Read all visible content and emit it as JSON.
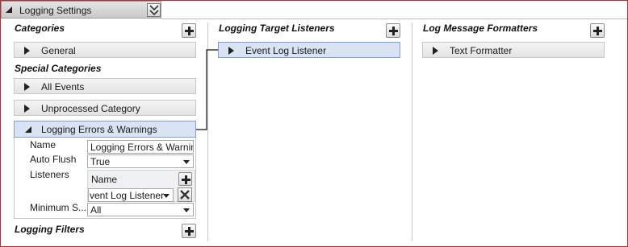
{
  "header": {
    "title": "Logging Settings"
  },
  "categories": {
    "label": "Categories",
    "items": [
      {
        "label": "General"
      }
    ]
  },
  "special_categories": {
    "label": "Special Categories",
    "items": [
      {
        "label": "All Events"
      },
      {
        "label": "Unprocessed Category"
      },
      {
        "label": "Logging Errors & Warnings"
      }
    ]
  },
  "properties": {
    "name_label": "Name",
    "name_value": "Logging Errors & Warning",
    "auto_flush_label": "Auto Flush",
    "auto_flush_value": "True",
    "listeners_label": "Listeners",
    "listeners_name_header": "Name",
    "listener_value": "vent Log Listener",
    "min_severity_label": "Minimum S...",
    "min_severity_value": "All"
  },
  "logging_filters": {
    "label": "Logging Filters"
  },
  "target_listeners": {
    "label": "Logging Target Listeners",
    "items": [
      {
        "label": "Event Log Listener"
      }
    ]
  },
  "formatters": {
    "label": "Log Message Formatters",
    "items": [
      {
        "label": "Text Formatter"
      }
    ]
  },
  "icons": {
    "collapse": "double-chevron-down-icon",
    "add": "plus-icon",
    "remove": "x-icon",
    "expand": "triangle-right-icon",
    "expanded": "triangle-down-icon",
    "dropdown": "dropdown-arrow-icon"
  },
  "colors": {
    "border": "#b03030",
    "selected": "#d9e3f3",
    "selected_border": "#7f9fd0"
  }
}
